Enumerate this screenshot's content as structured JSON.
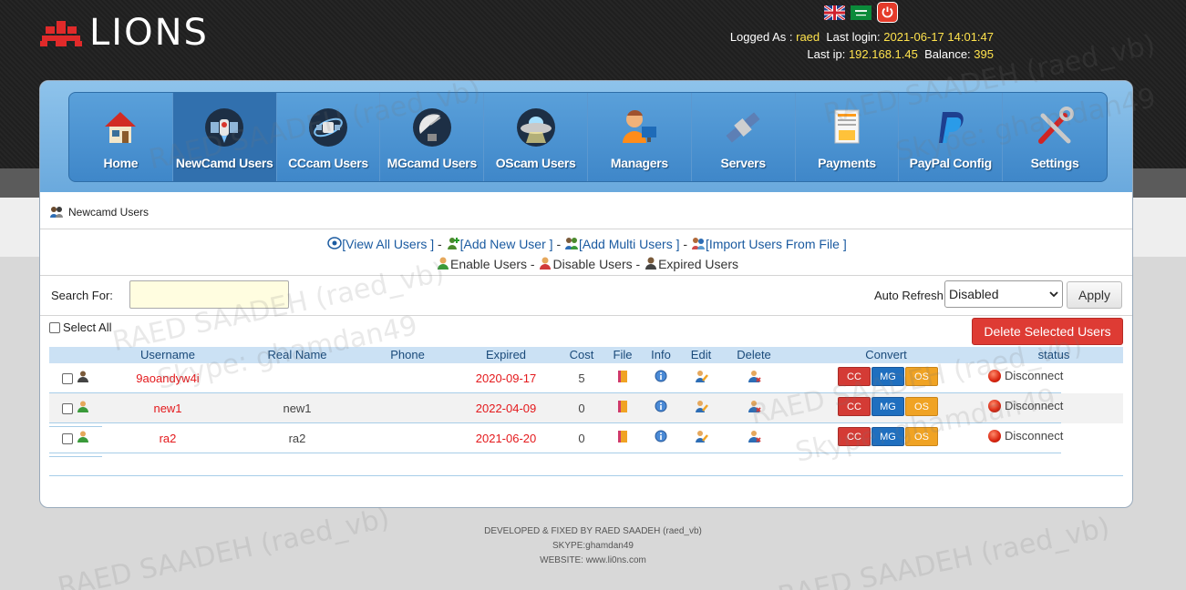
{
  "brand": {
    "name": "LIONS"
  },
  "header": {
    "logged_as_label": "Logged As :",
    "username": "raed",
    "last_login_label": "Last login:",
    "last_login": "2021-06-17 14:01:47",
    "last_ip_label": "Last ip:",
    "last_ip": "192.168.1.45",
    "balance_label": "Balance:",
    "balance": "395"
  },
  "nav": {
    "items": [
      {
        "label": "Home",
        "icon": "home-icon"
      },
      {
        "label": "NewCamd Users",
        "icon": "satellite-icon"
      },
      {
        "label": "CCcam Users",
        "icon": "satellite-orbit-icon"
      },
      {
        "label": "MGcamd Users",
        "icon": "dish-icon"
      },
      {
        "label": "OScam Users",
        "icon": "ufo-icon"
      },
      {
        "label": "Managers",
        "icon": "manager-icon"
      },
      {
        "label": "Servers",
        "icon": "server-satellite-icon"
      },
      {
        "label": "Payments",
        "icon": "payment-card-icon"
      },
      {
        "label": "PayPal Config",
        "icon": "paypal-icon"
      },
      {
        "label": "Settings",
        "icon": "tools-icon"
      }
    ],
    "active": "NewCamd Users"
  },
  "breadcrumb": {
    "title": "Newcamd Users"
  },
  "actions": {
    "view_all": "[View All Users ]",
    "add_new": "[Add New User ]",
    "add_multi": "[Add Multi Users ]",
    "import": "[Import Users From File ]",
    "enable": "Enable Users",
    "disable": "Disable Users",
    "expired": "Expired Users",
    "dash": "-"
  },
  "search": {
    "label": "Search For:",
    "value": ""
  },
  "auto_refresh": {
    "label": "Auto Refresh:",
    "selected": "Disabled",
    "apply": "Apply"
  },
  "select_all": "Select All",
  "delete_selected": "Delete Selected Users",
  "table": {
    "headers": {
      "username": "Username",
      "real_name": "Real Name",
      "phone": "Phone",
      "expired": "Expired",
      "cost": "Cost",
      "file": "File",
      "info": "Info",
      "edit": "Edit",
      "delete": "Delete",
      "convert": "Convert",
      "status": "status"
    },
    "convert_buttons": {
      "cc": "CC",
      "mg": "MG",
      "os": "OS"
    },
    "rows": [
      {
        "username": "9aoandyw4i",
        "real_name": "",
        "phone": "",
        "expired": "2020-09-17",
        "cost": "5",
        "status": "Disconnect"
      },
      {
        "username": "new1",
        "real_name": "new1",
        "phone": "",
        "expired": "2022-04-09",
        "cost": "0",
        "status": "Disconnect"
      },
      {
        "username": "ra2",
        "real_name": "ra2",
        "phone": "",
        "expired": "2021-06-20",
        "cost": "0",
        "status": "Disconnect"
      }
    ]
  },
  "footer": {
    "line1": "DEVELOPED & FIXED BY RAED SAADEH (raed_vb)",
    "line2": "SKYPE:ghamdan49",
    "line3": "WEBSITE: www.li0ns.com"
  },
  "watermark": {
    "name": "RAED SAADEH (raed_vb)",
    "skype": "Skype: ghamdan49"
  },
  "colors": {
    "accent": "#3f87c9",
    "header_value": "#ffe34d",
    "expired_red": "#e4191c",
    "delete_red": "#de3b34"
  }
}
